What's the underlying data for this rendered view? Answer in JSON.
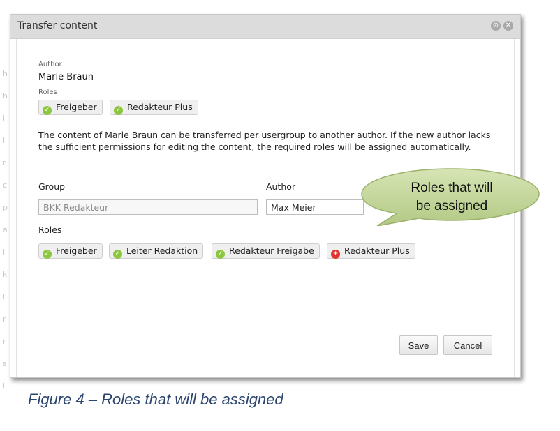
{
  "dialog": {
    "title": "Transfer content",
    "current": {
      "author_label": "Author",
      "author_name": "Marie Braun",
      "roles_label": "Roles",
      "roles": [
        "Freigeber",
        "Redakteur Plus"
      ]
    },
    "description": "The content of Marie Braun can be transferred per usergroup to another author. If the new author lacks the sufficient permissions for editing the content, the required roles will be assigned automatically.",
    "group_label": "Group",
    "group_value": "BKK Redakteur",
    "author_label": "Author",
    "author_value": "Max Meier",
    "roles_label": "Roles",
    "roles": [
      {
        "name": "Freigeber",
        "status": "ok"
      },
      {
        "name": "Leiter Redaktion",
        "status": "ok"
      },
      {
        "name": "Redakteur Freigabe",
        "status": "ok"
      },
      {
        "name": "Redakteur Plus",
        "status": "add"
      }
    ],
    "save_label": "Save",
    "cancel_label": "Cancel"
  },
  "callout": {
    "line1": "Roles that will",
    "line2": "be assigned"
  },
  "caption": "Figure 4 – Roles that will be assigned",
  "colors": {
    "ok_icon": "#8dc63f",
    "add_icon": "#e0342e",
    "callout_fill": "#c3d69b",
    "caption": "#2b4570"
  },
  "icons": [
    "minimize-icon",
    "close-icon",
    "check-icon",
    "plus-icon"
  ]
}
